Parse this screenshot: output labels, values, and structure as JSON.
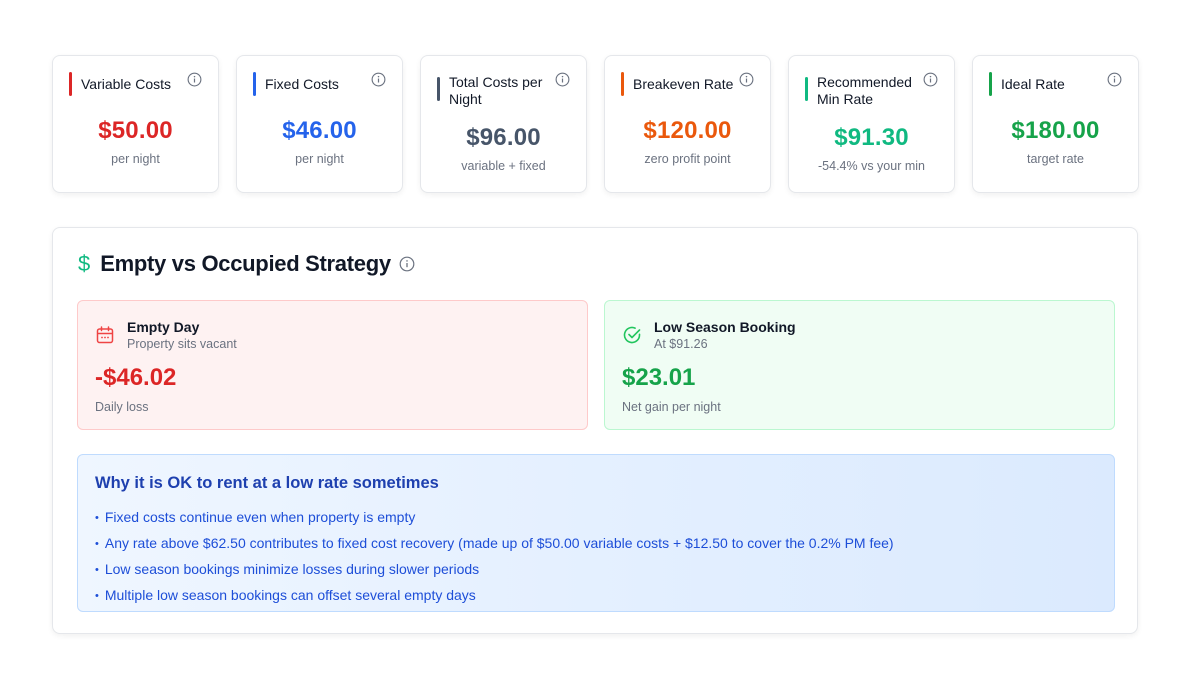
{
  "colors": {
    "red": "#dc2626",
    "blue": "#2563eb",
    "slate": "#475569",
    "orange": "#ea580c",
    "teal": "#10b981",
    "green": "#16a34a"
  },
  "metrics": [
    {
      "title": "Variable Costs",
      "value": "$50.00",
      "sub": "per night",
      "color": "#dc2626",
      "icon": "info-icon"
    },
    {
      "title": "Fixed Costs",
      "value": "$46.00",
      "sub": "per night",
      "color": "#2563eb",
      "icon": "info-icon"
    },
    {
      "title": "Total Costs per Night",
      "value": "$96.00",
      "sub": "variable + fixed",
      "color": "#475569",
      "icon": "info-icon"
    },
    {
      "title": "Breakeven Rate",
      "value": "$120.00",
      "sub": "zero profit point",
      "color": "#ea580c",
      "icon": "info-icon"
    },
    {
      "title": "Recommended Min Rate",
      "value": "$91.30",
      "sub": "-54.4% vs your min",
      "color": "#10b981",
      "icon": "info-icon"
    },
    {
      "title": "Ideal Rate",
      "value": "$180.00",
      "sub": "target rate",
      "color": "#16a34a",
      "icon": "info-icon"
    }
  ],
  "strategy": {
    "title": "Empty vs Occupied Strategy",
    "icon": "dollar-icon",
    "empty_day": {
      "title": "Empty Day",
      "sub": "Property sits vacant",
      "value": "-$46.02",
      "caption": "Daily loss",
      "icon": "calendar-icon"
    },
    "low_season": {
      "title": "Low Season Booking",
      "sub": "At $91.26",
      "value": "$23.01",
      "caption": "Net gain per night",
      "icon": "check-circle-icon"
    },
    "why": {
      "title": "Why it is OK to rent at a low rate sometimes",
      "points": [
        "Fixed costs continue even when property is empty",
        "Any rate above $62.50 contributes to fixed cost recovery (made up of $50.00 variable costs + $12.50 to cover the 0.2% PM fee)",
        "Low season bookings minimize losses during slower periods",
        "Multiple low season bookings can offset several empty days"
      ]
    }
  }
}
